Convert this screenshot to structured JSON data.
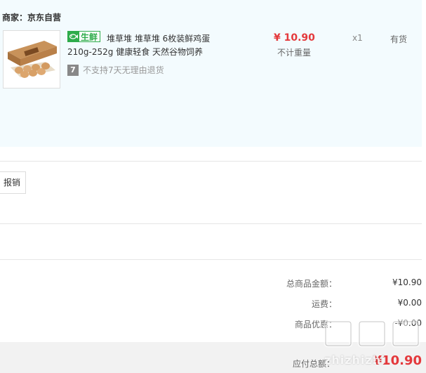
{
  "merchant": {
    "label": "商家：京东自营"
  },
  "product": {
    "badge": "生鲜",
    "name_line1": "堆草堆 堆草堆 6枚装鲜鸡蛋",
    "name_line2": "210g-252g 健康轻食 天然谷物饲养",
    "return_policy_icon": "7",
    "return_policy": "不支持7天无理由退货",
    "price": "¥ 10.90",
    "weight_note": "不计重量",
    "quantity": "x1",
    "stock": "有货",
    "image_icon": "egg-box-image"
  },
  "actions": {
    "reimburse_label": "报销"
  },
  "summary": {
    "rows": [
      {
        "label": "总商品金额：",
        "value": "¥10.90"
      },
      {
        "label": "运费：",
        "value": "¥0.00"
      },
      {
        "label": "商品优惠：",
        "value": "-¥0.00"
      }
    ],
    "payable_label": "应付总额：",
    "payable_value": "¥10.90"
  },
  "watermark": {
    "logo": "值值值",
    "text": "zhizhizhi"
  },
  "colors": {
    "panel_bg": "#f3fbfe",
    "price_red": "#e4393c",
    "fresh_green": "#2eac4b"
  }
}
